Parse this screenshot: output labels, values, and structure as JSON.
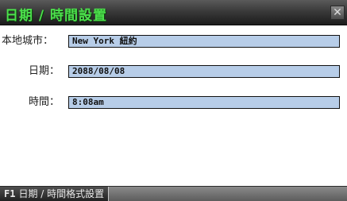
{
  "window": {
    "title": "日期 / 時間設置",
    "close_glyph": "✕"
  },
  "fields": [
    {
      "label": "本地城市：",
      "value": "New York 紐約"
    },
    {
      "label": "日期：",
      "value": "2088/08/08"
    },
    {
      "label": "時間：",
      "value": "8:08am"
    }
  ],
  "statusbar": {
    "key": "F1",
    "label": "日期 / 時間格式設置"
  },
  "colors": {
    "title_text": "#4ce04c",
    "field_background": "#b7cde8"
  }
}
